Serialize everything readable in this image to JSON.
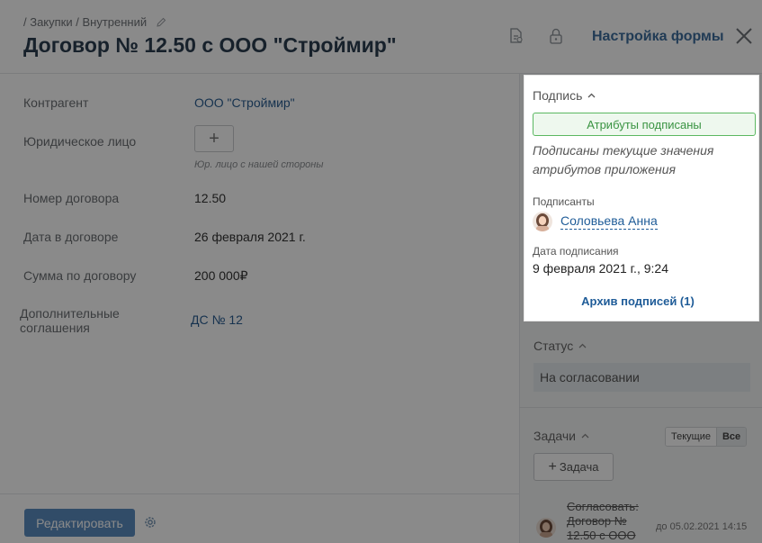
{
  "header": {
    "breadcrumb": "/ Закупки / Внутренний",
    "title": "Договор № 12.50 с ООО \"Строймир\"",
    "form_settings_label": "Настройка формы",
    "icons": [
      "document-sign-icon",
      "lock-icon",
      "close-icon"
    ]
  },
  "fields": {
    "contractor": {
      "label": "Контрагент",
      "value": "ООО \"Строймир\""
    },
    "legal_entity": {
      "label": "Юридическое лицо",
      "add_label": "+",
      "hint": "Юр. лицо с нашей стороны"
    },
    "contract_number": {
      "label": "Номер договора",
      "value": "12.50"
    },
    "contract_date": {
      "label": "Дата в договоре",
      "value": "26 февраля 2021 г."
    },
    "contract_sum": {
      "label": "Сумма по договору",
      "value": "200 000₽"
    },
    "additional_agreements": {
      "label_line1": "Дополнительные",
      "label_line2": "соглашения",
      "value": "ДС № 12"
    }
  },
  "footer": {
    "edit_label": "Редактировать"
  },
  "signature_panel": {
    "title": "Подпись",
    "badge": "Атрибуты подписаны",
    "note": "Подписаны текущие значения атрибутов приложения",
    "signers_label": "Подписанты",
    "signer_name": "Соловьева Анна",
    "date_label": "Дата подписания",
    "date_value": "9 февраля 2021 г., 9:24",
    "archive_label": "Архив подписей (1)"
  },
  "status": {
    "title": "Статус",
    "value": "На согласовании"
  },
  "tasks": {
    "title": "Задачи",
    "filter_current": "Текущие",
    "filter_all": "Все",
    "add_label": "Задача",
    "item_text": "Согласовать: Договор № 12.50 с ООО",
    "item_due": "до 05.02.2021 14:15"
  },
  "colors": {
    "accent": "#1f5c98",
    "success": "#3a9442",
    "button": "#5b8cc0"
  }
}
